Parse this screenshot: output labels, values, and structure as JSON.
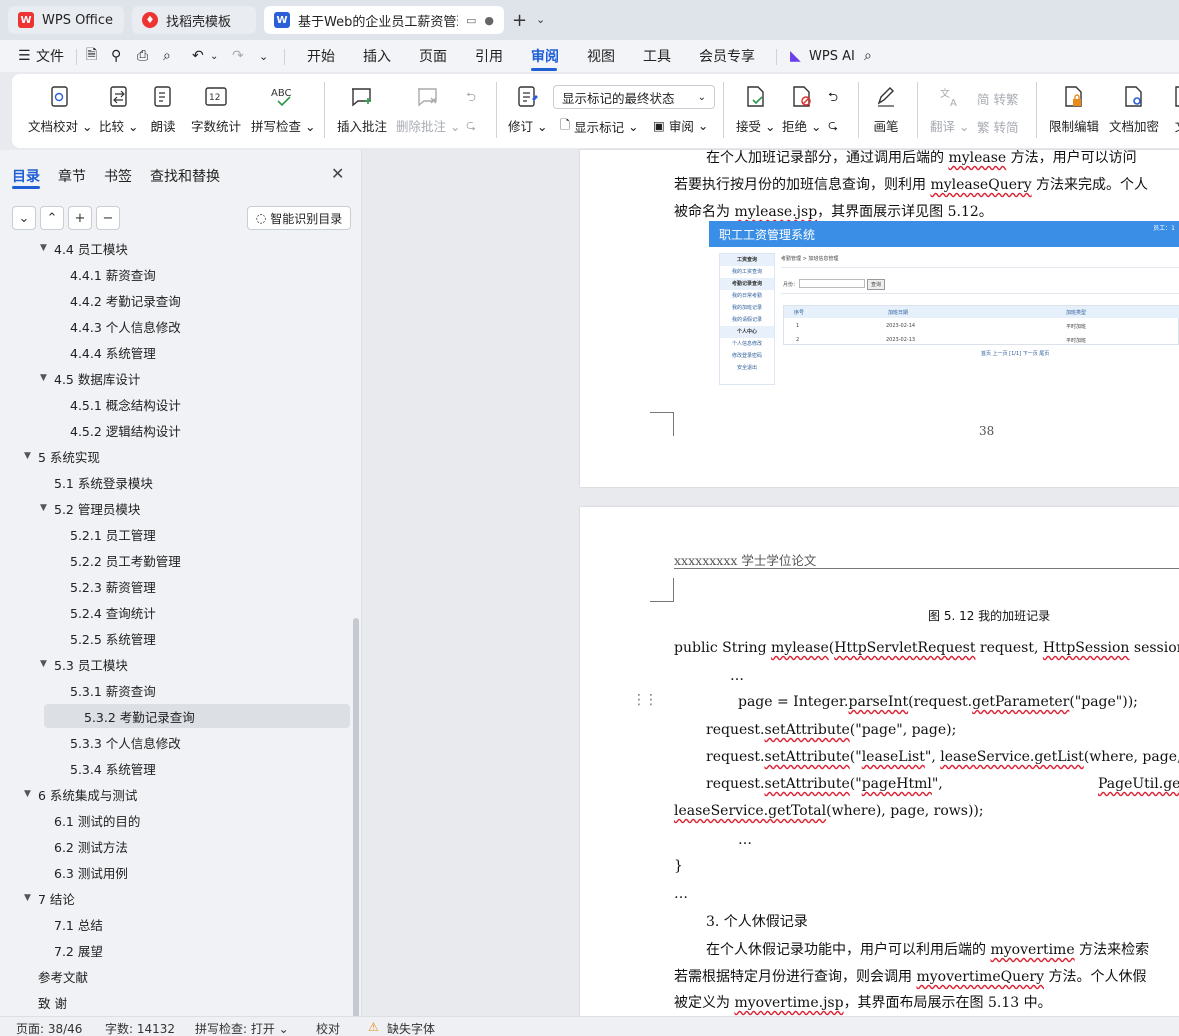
{
  "tabs": [
    {
      "label": "WPS Office",
      "icon": "wps-logo-icon",
      "color": "#e33"
    },
    {
      "label": "找稻壳模板",
      "icon": "docer-icon",
      "color": "#e33"
    },
    {
      "label": "基于Web的企业员工薪资管理",
      "icon": "writer-doc-icon",
      "color": "#2b5fd9"
    }
  ],
  "menu": {
    "file": "文件",
    "items": [
      "开始",
      "插入",
      "页面",
      "引用",
      "审阅",
      "视图",
      "工具",
      "会员专享"
    ],
    "active": "审阅",
    "wps_ai": "WPS AI"
  },
  "ribbon": {
    "doc_check": "文档校对",
    "compare": "比较",
    "read_aloud": "朗读",
    "word_count": "字数统计",
    "spell_check": "拼写检查",
    "spell_icon_text": "ABC",
    "insert_comment": "插入批注",
    "delete_comment": "删除批注",
    "track": "修订",
    "markup_select": "显示标记的最终状态",
    "show_markup": "显示标记",
    "review": "审阅",
    "accept": "接受",
    "reject": "拒绝",
    "ink": "画笔",
    "translate": "翻译",
    "to_traditional": "简 转繁",
    "to_simplified": "繁 转简",
    "restrict": "限制编辑",
    "encrypt": "文档加密",
    "overflow": "文"
  },
  "panel": {
    "tabs": [
      "目录",
      "章节",
      "书签",
      "查找和替换"
    ],
    "smart_button": "智能识别目录",
    "toc": [
      {
        "label": "4.4 员工模块",
        "level": 2,
        "caret": true
      },
      {
        "label": "4.4.1  薪资查询",
        "level": 3
      },
      {
        "label": "4.4.2  考勤记录查询",
        "level": 3
      },
      {
        "label": "4.4.3  个人信息修改",
        "level": 3
      },
      {
        "label": "4.4.4  系统管理",
        "level": 3
      },
      {
        "label": "4.5 数据库设计",
        "level": 2,
        "caret": true
      },
      {
        "label": "4.5.1  概念结构设计",
        "level": 3
      },
      {
        "label": "4.5.2  逻辑结构设计",
        "level": 3
      },
      {
        "label": "5 系统实现",
        "level": 1,
        "caret": true
      },
      {
        "label": "5.1  系统登录模块",
        "level": 2
      },
      {
        "label": "5.2  管理员模块",
        "level": 2,
        "caret": true
      },
      {
        "label": "5.2.1  员工管理",
        "level": 3
      },
      {
        "label": "5.2.2  员工考勤管理",
        "level": 3
      },
      {
        "label": "5.2.3  薪资管理",
        "level": 3
      },
      {
        "label": "5.2.4  查询统计",
        "level": 3
      },
      {
        "label": "5.2.5  系统管理",
        "level": 3
      },
      {
        "label": "5.3  员工模块",
        "level": 2,
        "caret": true
      },
      {
        "label": "5.3.1  薪资查询",
        "level": 3
      },
      {
        "label": "5.3.2  考勤记录查询",
        "level": 3,
        "selected": true
      },
      {
        "label": "5.3.3  个人信息修改",
        "level": 3
      },
      {
        "label": "5.3.4  系统管理",
        "level": 3
      },
      {
        "label": "6 系统集成与测试",
        "level": 1,
        "caret": true
      },
      {
        "label": "6.1  测试的目的",
        "level": 2
      },
      {
        "label": "6.2  测试方法",
        "level": 2
      },
      {
        "label": "6.3  测试用例",
        "level": 2
      },
      {
        "label": "7 结论",
        "level": 1,
        "caret": true
      },
      {
        "label": "7.1 总结",
        "level": 2
      },
      {
        "label": "7.2 展望",
        "level": 2
      },
      {
        "label": "参考文献",
        "level": 1
      },
      {
        "label": "致  谢",
        "level": 1
      }
    ]
  },
  "document": {
    "page1": {
      "line1": "在个人加班记录部分，通过调用后端的 mylease 方法，用户可以访问",
      "line2": "若要执行按月份的加班信息查询，则利用 myleaseQuery 方法来完成。个人",
      "line3": "被命名为 mylease.jsp，其界面展示详见图 5.12。",
      "page_number": "38"
    },
    "app_screenshot": {
      "title": "职工工资管理系统",
      "user": "员工：1",
      "breadcrumb": "考勤管理 > 加班信息管理",
      "month_label": "月份：",
      "search_btn": "查询",
      "side": [
        "工资查询",
        "我的工资查询",
        "考勤记录查询",
        "我的日常考勤",
        "我的加班记录",
        "我的请假记录",
        "个人中心",
        "个人信息修改",
        "修改登录密码",
        "安全退出"
      ],
      "columns": [
        "序号",
        "加班日期",
        "加班类型"
      ],
      "rows": [
        [
          "1",
          "2023-02-14",
          "平时加班"
        ],
        [
          "2",
          "2023-02-13",
          "平时加班"
        ]
      ],
      "pager": "首页 上一页 [1/1] 下一页 尾页"
    },
    "page2": {
      "header": "xxxxxxxxx 学士学位论文",
      "caption": "图 5. 12  我的加班记录",
      "code1": "public String mylease(HttpServletRequest request, HttpSession session) {",
      "ellipsis1": "…",
      "code2": "page = Integer.parseInt(request.getParameter(\"page\"));",
      "code3": "request.setAttribute(\"page\", page);",
      "code4": "request.setAttribute(\"leaseList\", leaseService.getList(where, page, rows));",
      "code5a": "request.setAttribute(\"pageHtml\",",
      "code5b": "PageUtil.getP",
      "code6": "leaseService.getTotal(where), page, rows));",
      "ellipsis2": "…",
      "brace": "}",
      "ellipsis3": "…",
      "heading3": "3. 个人休假记录",
      "para1": "在个人休假记录功能中，用户可以利用后端的 myovertime 方法来检索",
      "para2": "若需根据特定月份进行查询，则会调用 myovertimeQuery 方法。个人休假",
      "para3": "被定义为 myovertime.jsp，其界面布局展示在图 5.13 中。"
    }
  },
  "status": {
    "page": "页面: 38/46",
    "words": "字数: 14132",
    "spell": "拼写检查: 打开",
    "proof": "校对",
    "missing_font": "缺失字体"
  }
}
